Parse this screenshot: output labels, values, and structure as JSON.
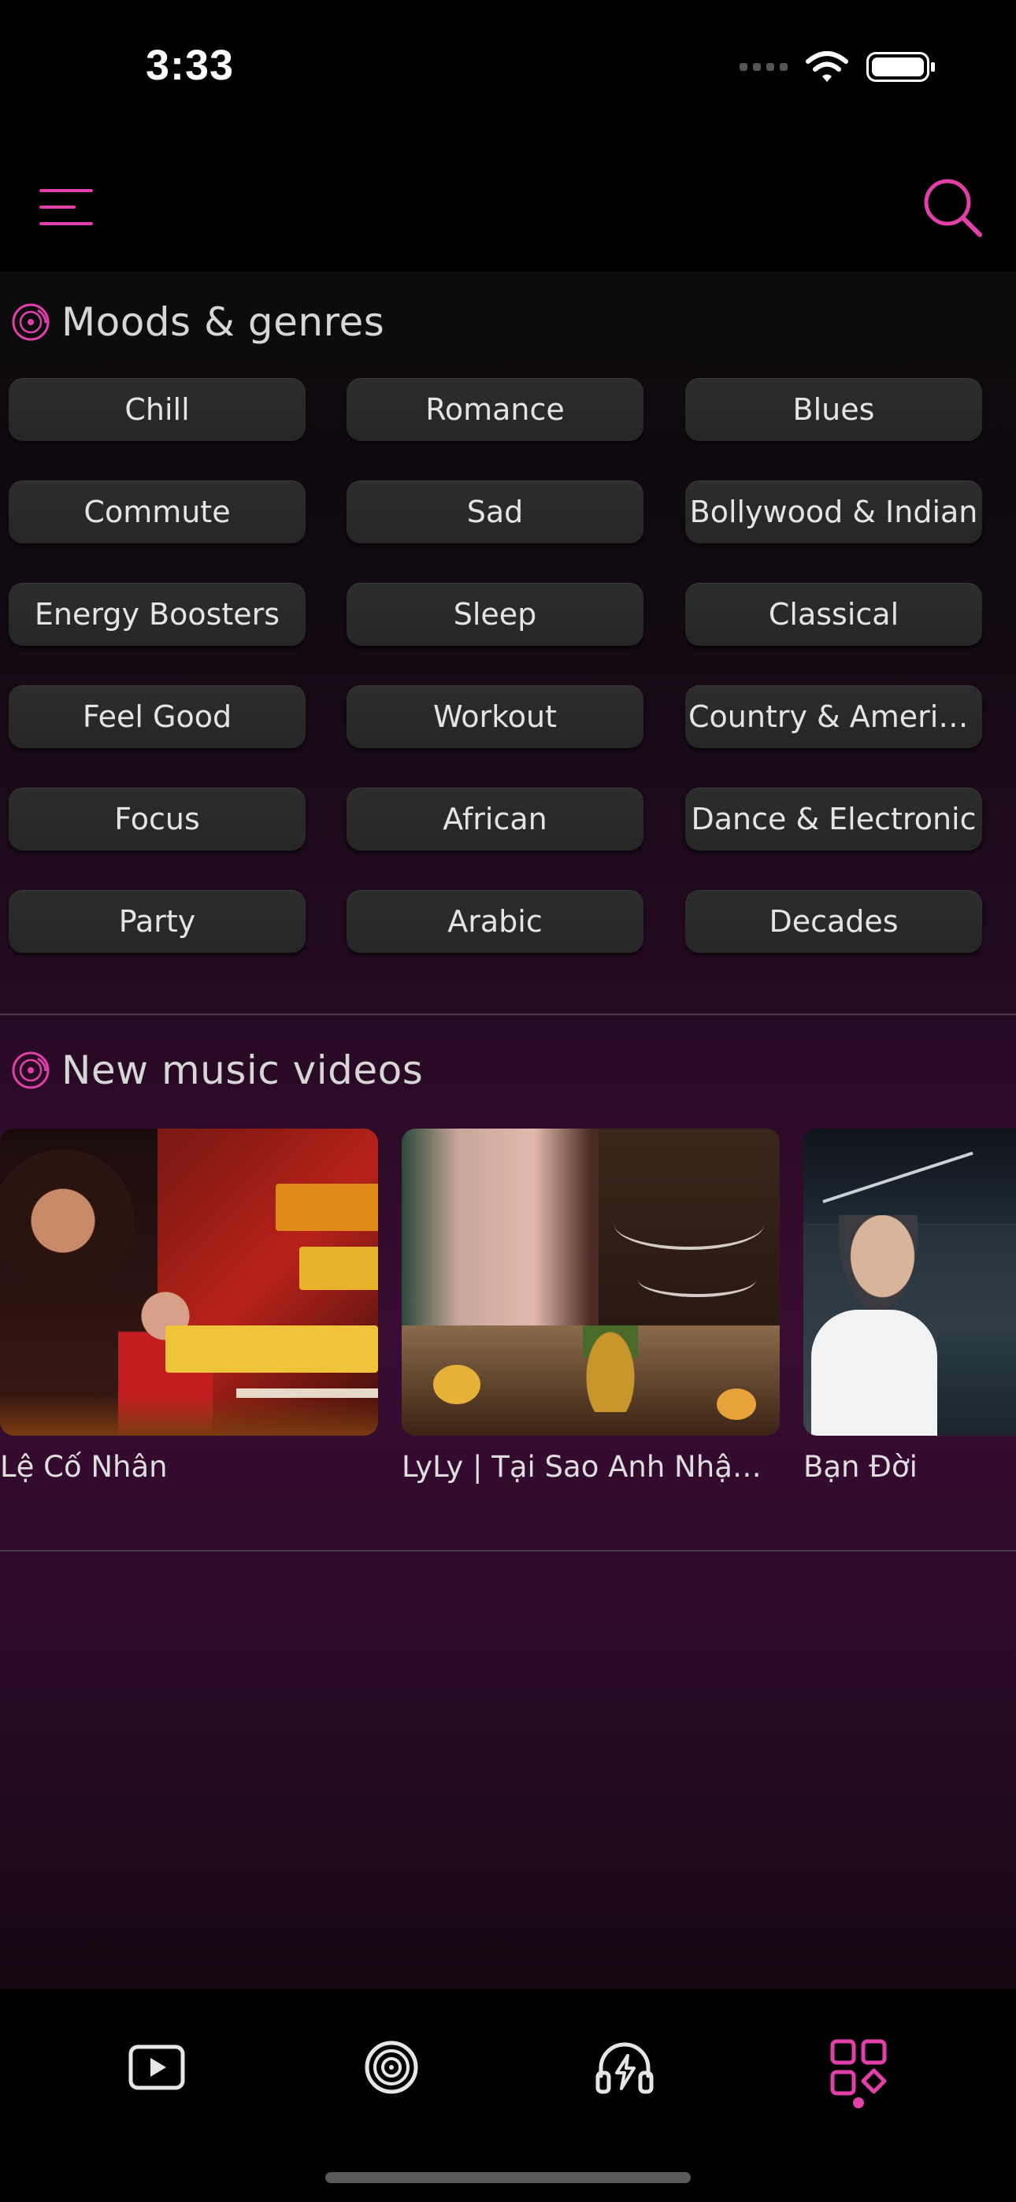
{
  "status_bar": {
    "time": "3:33"
  },
  "colors": {
    "accent": "#e040a8",
    "background": "#000000",
    "chip": "#2a2a2a"
  },
  "header": {
    "menu_icon": "hamburger-menu-icon",
    "search_icon": "search-icon"
  },
  "moods": {
    "title": "Moods & genres",
    "icon": "vinyl-disc-icon",
    "items": [
      {
        "label": "Chill"
      },
      {
        "label": "Romance"
      },
      {
        "label": "Blues"
      },
      {
        "label": "Commute"
      },
      {
        "label": "Sad"
      },
      {
        "label": "Bollywood & Indian"
      },
      {
        "label": "Energy Boosters"
      },
      {
        "label": "Sleep"
      },
      {
        "label": "Classical"
      },
      {
        "label": "Feel Good"
      },
      {
        "label": "Workout"
      },
      {
        "label": "Country & Americ..."
      },
      {
        "label": "Focus"
      },
      {
        "label": "African"
      },
      {
        "label": "Dance & Electronic"
      },
      {
        "label": "Party"
      },
      {
        "label": "Arabic"
      },
      {
        "label": "Decades"
      }
    ]
  },
  "videos": {
    "title": "New music videos",
    "icon": "vinyl-disc-icon",
    "items": [
      {
        "title": "Lệ Cố Nhân"
      },
      {
        "title": "LyLy | Tại Sao Anh Nhận ..."
      },
      {
        "title": "Bạn Đời"
      }
    ]
  },
  "tabbar": {
    "tabs": [
      {
        "icon": "video-play-icon"
      },
      {
        "icon": "vinyl-disc-icon"
      },
      {
        "icon": "headphones-lightning-icon"
      },
      {
        "icon": "grid-apps-icon",
        "active": true
      }
    ]
  }
}
